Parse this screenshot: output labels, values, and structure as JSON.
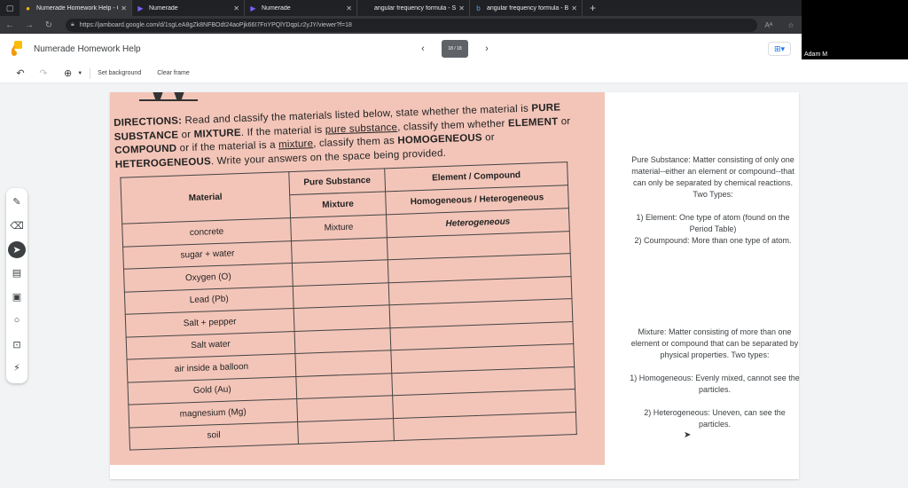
{
  "browser": {
    "tabs": [
      {
        "title": "Numerade Homework Help - Goo",
        "icon": "jamboard-icon",
        "active": true
      },
      {
        "title": "Numerade",
        "icon": "numerade-icon",
        "active": false
      },
      {
        "title": "Numerade",
        "icon": "numerade-icon",
        "active": false
      },
      {
        "title": "angular frequency formula - Sear",
        "icon": "search-icon",
        "active": false
      },
      {
        "title": "angular frequency formula - Bing",
        "icon": "bing-icon",
        "active": false
      }
    ],
    "url": "https://jamboard.google.com/d/1sgLeA8gZk8NFBOdt24aoPjk66I7FnYPQlYDqpLr2yJY/viewer?f=18"
  },
  "video": {
    "participant_name": "Adam M"
  },
  "app": {
    "title": "Numerade Homework Help",
    "frame_indicator": "18 / 18"
  },
  "toolbar": {
    "set_background": "Set background",
    "clear_frame": "Clear frame"
  },
  "worksheet": {
    "directions": {
      "line1_bold": "DIRECTIONS:",
      "line1": " Read and classify the materials listed below, state whether the material is",
      "pure": "PURE SUBSTANCE",
      "or1": " or ",
      "mixture": "MIXTURE",
      "rest1": ". If the material is ",
      "pure_sub_u": "pure substance",
      "rest2": ", classify them whether",
      "element": "ELEMENT",
      "or2": " or ",
      "compound": "COMPOUND",
      "rest3": " or if the material is a ",
      "mixture_u": "mixture",
      "rest4": ", classify them as",
      "homogeneous": "HOMOGENEOUS",
      "or3": " or ",
      "heterogeneous": "HETEROGENEOUS",
      "rest5": ". Write your answers on the space being provided."
    },
    "table": {
      "headers": {
        "material": "Material",
        "pure_substance": "Pure Substance",
        "mixture": "Mixture",
        "element_compound": "Element / Compound",
        "homo_hetero": "Homogeneous / Heterogeneous"
      },
      "rows": [
        {
          "material": "concrete",
          "type": "Mixture",
          "classification": "Heterogeneous"
        },
        {
          "material": "sugar + water",
          "type": "",
          "classification": ""
        },
        {
          "material": "Oxygen (O)",
          "type": "",
          "classification": ""
        },
        {
          "material": "Lead (Pb)",
          "type": "",
          "classification": ""
        },
        {
          "material": "Salt + pepper",
          "type": "",
          "classification": ""
        },
        {
          "material": "Salt water",
          "type": "",
          "classification": ""
        },
        {
          "material": "air inside a balloon",
          "type": "",
          "classification": ""
        },
        {
          "material": "Gold (Au)",
          "type": "",
          "classification": ""
        },
        {
          "material": "magnesium (Mg)",
          "type": "",
          "classification": ""
        },
        {
          "material": "soil",
          "type": "",
          "classification": ""
        }
      ]
    }
  },
  "notes": {
    "pure": {
      "p1": "Pure Substance:  Matter consisting of only one material--either an element or compound--that can only be separated by chemical reactions. Two Types:",
      "p2": "1) Element:  One type of atom (found on the Period Table)",
      "p3": "2) Coumpound:  More than one type of atom."
    },
    "mixture": {
      "p1": "Mixture:  Matter consisting of more than one element or compound that can be separated by physical properties. Two types:",
      "p2": "1) Homogeneous:  Evenly mixed, cannot see the particles.",
      "p3": "2) Heterogeneous:  Uneven, can see the particles."
    }
  }
}
